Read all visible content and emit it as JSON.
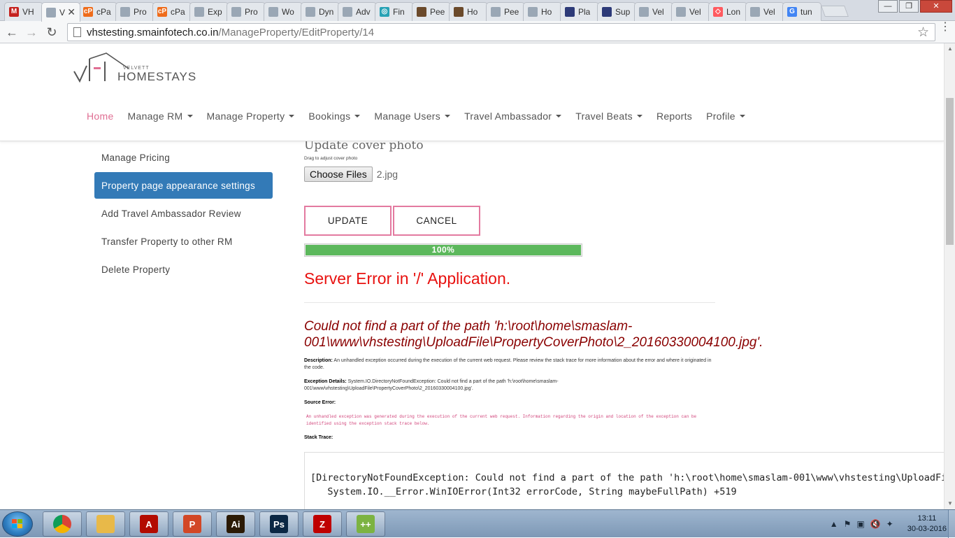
{
  "browser": {
    "tabs": [
      {
        "title": "VH",
        "favicon_color": "#c5221f",
        "favicon_glyph": "M",
        "active": false
      },
      {
        "title": "V",
        "favicon_color": "#9aa7b5",
        "favicon_glyph": "",
        "active": true
      },
      {
        "title": "cPa",
        "favicon_color": "#ef6c1b",
        "favicon_glyph": "cP",
        "active": false
      },
      {
        "title": "Pro",
        "favicon_color": "#9aa7b5",
        "favicon_glyph": "",
        "active": false
      },
      {
        "title": "cPa",
        "favicon_color": "#ef6c1b",
        "favicon_glyph": "cP",
        "active": false
      },
      {
        "title": "Exp",
        "favicon_color": "#9aa7b5",
        "favicon_glyph": "",
        "active": false
      },
      {
        "title": "Pro",
        "favicon_color": "#9aa7b5",
        "favicon_glyph": "",
        "active": false
      },
      {
        "title": "Wo",
        "favicon_color": "#9aa7b5",
        "favicon_glyph": "",
        "active": false
      },
      {
        "title": "Dyn",
        "favicon_color": "#9aa7b5",
        "favicon_glyph": "",
        "active": false
      },
      {
        "title": "Adv",
        "favicon_color": "#9aa7b5",
        "favicon_glyph": "",
        "active": false
      },
      {
        "title": "Fin",
        "favicon_color": "#27a2b5",
        "favicon_glyph": "◎",
        "active": false
      },
      {
        "title": "Pee",
        "favicon_color": "#6b4a2b",
        "favicon_glyph": "",
        "active": false
      },
      {
        "title": "Ho",
        "favicon_color": "#6b4a2b",
        "favicon_glyph": "",
        "active": false
      },
      {
        "title": "Pee",
        "favicon_color": "#9aa7b5",
        "favicon_glyph": "",
        "active": false
      },
      {
        "title": "Ho",
        "favicon_color": "#9aa7b5",
        "favicon_glyph": "",
        "active": false
      },
      {
        "title": "Pla",
        "favicon_color": "#2d3a78",
        "favicon_glyph": "",
        "active": false
      },
      {
        "title": "Sup",
        "favicon_color": "#2d3a78",
        "favicon_glyph": "",
        "active": false
      },
      {
        "title": "Vel",
        "favicon_color": "#9aa7b5",
        "favicon_glyph": "",
        "active": false
      },
      {
        "title": "Vel",
        "favicon_color": "#9aa7b5",
        "favicon_glyph": "",
        "active": false
      },
      {
        "title": "Lon",
        "favicon_color": "#ff5a5f",
        "favicon_glyph": "◇",
        "active": false
      },
      {
        "title": "Vel",
        "favicon_color": "#9aa7b5",
        "favicon_glyph": "",
        "active": false
      },
      {
        "title": "tun",
        "favicon_color": "#4285f4",
        "favicon_glyph": "G",
        "active": false
      }
    ],
    "close_tab_glyph": "✕",
    "window_buttons": {
      "minimize": "—",
      "maximize": "❐",
      "close": "✕"
    },
    "nav": {
      "back": "←",
      "forward": "→",
      "reload": "↻"
    },
    "url_host": "vhstesting.smainfotech.co.in",
    "url_path": "/ManageProperty/EditProperty/14",
    "bookmark_icon": "star-icon",
    "bookmark_glyph": "☆",
    "menu_glyph": "⋮"
  },
  "site": {
    "logo_small": "VELVETT",
    "logo_big": "HOMESTAYS",
    "accent_color": "#e06f93",
    "nav": [
      {
        "label": "Home",
        "caret": false
      },
      {
        "label": "Manage RM",
        "caret": true
      },
      {
        "label": "Manage Property",
        "caret": true
      },
      {
        "label": "Bookings",
        "caret": true
      },
      {
        "label": "Manage Users",
        "caret": true
      },
      {
        "label": "Travel Ambassador",
        "caret": true
      },
      {
        "label": "Travel Beats",
        "caret": true
      },
      {
        "label": "Reports",
        "caret": false
      },
      {
        "label": "Profile",
        "caret": true
      }
    ]
  },
  "sidemenu": [
    {
      "label": "Manage Pricing",
      "active": false
    },
    {
      "label": "Property page appearance settings",
      "active": true
    },
    {
      "label": "Add Travel Ambassador Review",
      "active": false
    },
    {
      "label": "Transfer Property to other RM",
      "active": false
    },
    {
      "label": "Delete Property",
      "active": false
    }
  ],
  "main": {
    "cover_title": "Update cover photo",
    "cover_hint": "Drag to adjust cover photo",
    "choose_files_label": "Choose Files",
    "chosen_file": "2.jpg",
    "update_label": "UPDATE",
    "cancel_label": "CANCEL",
    "progress_percent": 100,
    "progress_label": "100%"
  },
  "error": {
    "title": "Server Error in '/' Application.",
    "message": "Could not find a part of the path 'h:\\root\\home\\smaslam-001\\www\\vhstesting\\UploadFile\\PropertyCoverPhoto\\2_20160330004100.jpg'.",
    "description_label": "Description:",
    "description_text": " An unhandled exception occurred during the execution of the current web request. Please review the stack trace for more information about the error and where it originated in the code.",
    "exception_label": "Exception Details:",
    "exception_text": " System.IO.DirectoryNotFoundException: Could not find a part of the path 'h:\\root\\home\\smaslam-001\\www\\vhstesting\\UploadFile\\PropertyCoverPhoto\\2_20160330004100.jpg'.",
    "source_label": "Source Error:",
    "source_text": "An unhandled exception was generated during the execution of the current web request. Information regarding the origin and location of the exception can be identified using the exception stack trace below.",
    "stack_label": "Stack Trace:",
    "stack_line1": "[DirectoryNotFoundException: Could not find a part of the path 'h:\\root\\home\\smaslam-001\\www\\vhstesting\\UploadFil",
    "stack_line2": "   System.IO.__Error.WinIOError(Int32 errorCode, String maybeFullPath) +519"
  },
  "taskbar": {
    "apps": [
      {
        "name": "chrome",
        "color": "#4285f4",
        "glyph": ""
      },
      {
        "name": "file-explorer",
        "color": "#e8b949",
        "glyph": ""
      },
      {
        "name": "acrobat",
        "color": "#b30b00",
        "glyph": "A"
      },
      {
        "name": "powerpoint",
        "color": "#d24726",
        "glyph": "P"
      },
      {
        "name": "illustrator",
        "color": "#2b1a05",
        "glyph": "Ai"
      },
      {
        "name": "photoshop",
        "color": "#0b2744",
        "glyph": "Ps"
      },
      {
        "name": "filezilla",
        "color": "#bf0000",
        "glyph": "Z"
      },
      {
        "name": "notepad-plus",
        "color": "#7cb342",
        "glyph": "++"
      }
    ],
    "tray_icons": [
      "▲",
      "⚑",
      "▣",
      "🔇",
      "✦"
    ],
    "time": "13:11",
    "date": "30-03-2016"
  }
}
